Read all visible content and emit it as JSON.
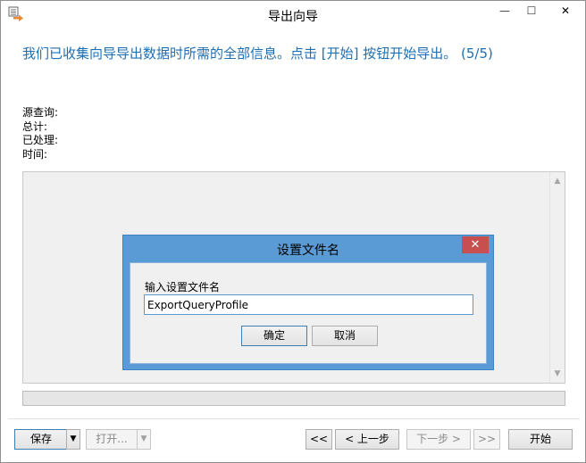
{
  "window": {
    "title": "导出向导",
    "minimize_glyph": "—",
    "maximize_glyph": "☐",
    "close_glyph": "✕"
  },
  "wizard": {
    "headline": "我们已收集向导导出数据时所需的全部信息。点击 [开始] 按钮开始导出。 (5/5)",
    "info": [
      "源查询:",
      "总计:",
      "已处理:",
      "时间:"
    ]
  },
  "dialog": {
    "title": "设置文件名",
    "label": "输入设置文件名",
    "input_value": "ExportQueryProfile",
    "ok_label": "确定",
    "cancel_label": "取消",
    "close_glyph": "✕"
  },
  "footer": {
    "save_label": "保存",
    "open_label": "打开...",
    "first_label": "<<",
    "prev_label": "< 上一步",
    "next_label": "下一步 >",
    "last_label": ">>",
    "start_label": "开始"
  },
  "colors": {
    "accent": "#1e6fb4",
    "dialog_frame": "#5b9bd5",
    "dialog_close": "#c74f4f"
  }
}
